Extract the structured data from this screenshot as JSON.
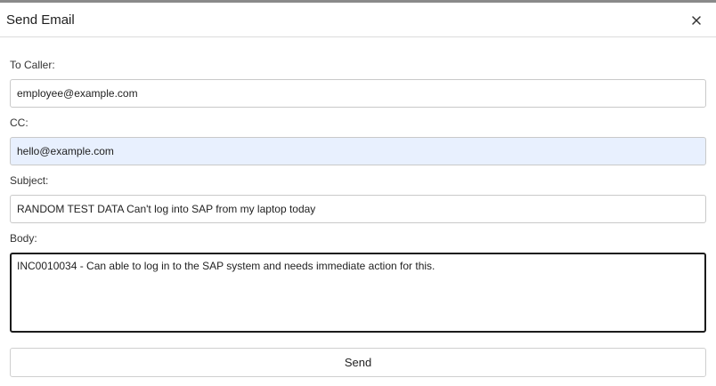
{
  "dialog": {
    "title": "Send Email",
    "close_icon": "close-icon"
  },
  "form": {
    "to_label": "To Caller:",
    "to_value": "employee@example.com",
    "cc_label": "CC:",
    "cc_value": "hello@example.com",
    "subject_label": "Subject:",
    "subject_value": "RANDOM TEST DATA Can't log into SAP from my laptop today",
    "body_label": "Body:",
    "body_value": "INC0010034 - Can able to log in to the SAP system and needs immediate action for this.",
    "send_label": "Send"
  },
  "colors": {
    "cc_field_bg": "#e8f0fe",
    "body_border": "#1b1b1b"
  }
}
